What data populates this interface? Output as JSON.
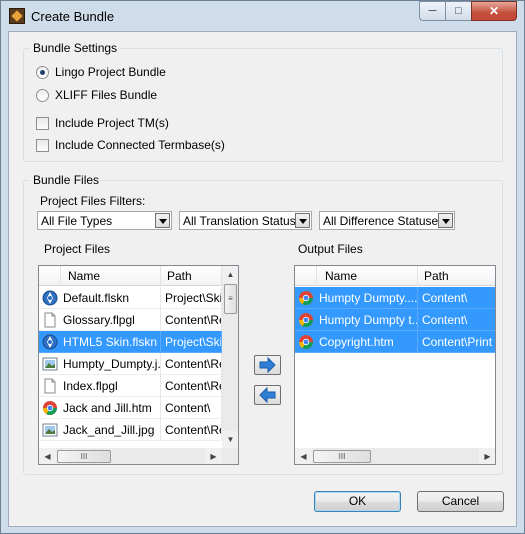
{
  "window": {
    "title": "Create Bundle",
    "minimize_glyph": "─",
    "maximize_glyph": "□",
    "close_glyph": "✕"
  },
  "bundle_settings": {
    "title": "Bundle Settings",
    "radio_lingo": "Lingo Project Bundle",
    "radio_xliff": "XLIFF Files Bundle",
    "check_tm": "Include Project TM(s)",
    "check_termbase": "Include Connected Termbase(s)",
    "selected": "lingo"
  },
  "bundle_files": {
    "title": "Bundle Files",
    "filters_label": "Project Files Filters:",
    "filter_types": "All File Types",
    "filter_translation": "All Translation Statuses",
    "filter_difference": "All Difference Statuses",
    "project_files_label": "Project Files",
    "output_files_label": "Output Files"
  },
  "project_files": {
    "columns": [
      "Name",
      "Path"
    ],
    "rows": [
      {
        "name": "Default.flskn",
        "path": "Project\\Skin",
        "icon": "skin-icon",
        "selected": false
      },
      {
        "name": "Glossary.flpgl",
        "path": "Content\\Res",
        "icon": "document-icon",
        "selected": false
      },
      {
        "name": "HTML5 Skin.flskn",
        "path": "Project\\Skin",
        "icon": "skin-icon",
        "selected": true
      },
      {
        "name": "Humpty_Dumpty.j...",
        "path": "Content\\Res",
        "icon": "image-icon",
        "selected": false
      },
      {
        "name": "Index.flpgl",
        "path": "Content\\Res",
        "icon": "document-icon",
        "selected": false
      },
      {
        "name": "Jack and Jill.htm",
        "path": "Content\\",
        "icon": "chrome-icon",
        "selected": false
      },
      {
        "name": "Jack_and_Jill.jpg",
        "path": "Content\\Res",
        "icon": "image-icon",
        "selected": false
      }
    ]
  },
  "output_files": {
    "columns": [
      "Name",
      "Path"
    ],
    "rows": [
      {
        "name": "Humpty Dumpty.....",
        "path": "Content\\",
        "icon": "chrome-icon"
      },
      {
        "name": "Humpty Dumpty t...",
        "path": "Content\\",
        "icon": "chrome-icon"
      },
      {
        "name": "Copyright.htm",
        "path": "Content\\Print On",
        "icon": "chrome-icon"
      }
    ]
  },
  "scroll_glyphs": {
    "up": "▲",
    "down": "▼",
    "left": "◀",
    "right": "▶",
    "grip_h": "III",
    "grip_v": "≡"
  },
  "buttons": {
    "ok": "OK",
    "cancel": "Cancel"
  },
  "colors": {
    "selection": "#3399ff",
    "arrow_blue": "#2f7fd6"
  }
}
